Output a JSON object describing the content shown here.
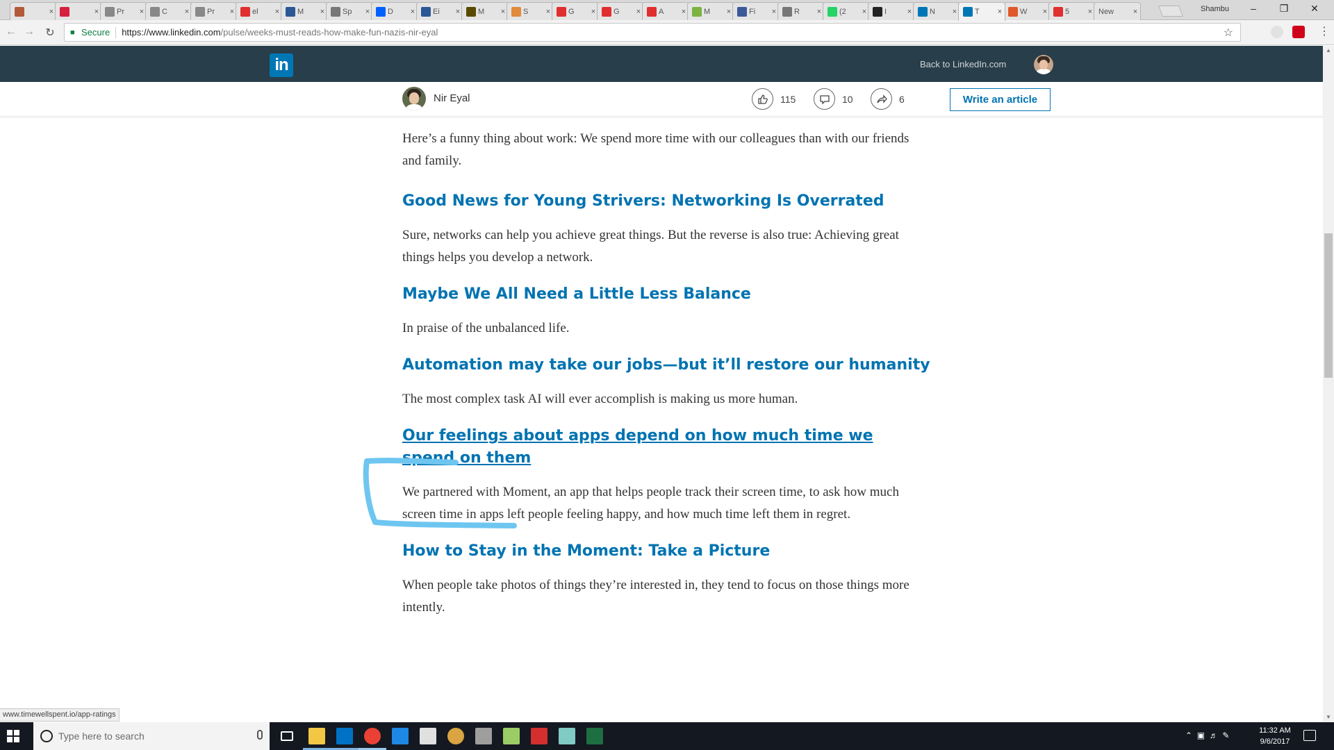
{
  "browser": {
    "tabs": [
      {
        "icon": "generic-page",
        "title": "",
        "color": "#b35a3a",
        "active": false
      },
      {
        "icon": "red-app",
        "title": "",
        "color": "#d6203f",
        "active": false
      },
      {
        "icon": "generic-page",
        "title": "Pr",
        "color": "#888888",
        "active": false
      },
      {
        "icon": "generic-page",
        "title": "C",
        "color": "#888888",
        "active": false
      },
      {
        "icon": "generic-page",
        "title": "Pr",
        "color": "#888888",
        "active": false
      },
      {
        "icon": "adobe",
        "title": "el",
        "color": "#e02f2f",
        "active": false
      },
      {
        "icon": "x-app",
        "title": "M",
        "color": "#2b5797",
        "active": false
      },
      {
        "icon": "stack",
        "title": "Sp",
        "color": "#777777",
        "active": false
      },
      {
        "icon": "dropbox",
        "title": "D",
        "color": "#0061fe",
        "active": false
      },
      {
        "icon": "x-app",
        "title": "Ei",
        "color": "#2b5797",
        "active": false
      },
      {
        "icon": "sp-app",
        "title": "M",
        "color": "#5a4a00",
        "active": false
      },
      {
        "icon": "book",
        "title": "S",
        "color": "#e08a3a",
        "active": false
      },
      {
        "icon": "adobe",
        "title": "G",
        "color": "#e02f2f",
        "active": false
      },
      {
        "icon": "adobe",
        "title": "G",
        "color": "#e02f2f",
        "active": false
      },
      {
        "icon": "adobe",
        "title": "A",
        "color": "#e02f2f",
        "active": false
      },
      {
        "icon": "leaf",
        "title": "M",
        "color": "#7cb342",
        "active": false
      },
      {
        "icon": "facebook",
        "title": "Fi",
        "color": "#3b5998",
        "active": false
      },
      {
        "icon": "gear",
        "title": "R",
        "color": "#777777",
        "active": false
      },
      {
        "icon": "green-circle",
        "title": "(2",
        "color": "#25d366",
        "active": false
      },
      {
        "icon": "medium",
        "title": "I",
        "color": "#222222",
        "active": false
      },
      {
        "icon": "linkedin",
        "title": "N",
        "color": "#0077b5",
        "active": false
      },
      {
        "icon": "linkedin",
        "title": "T",
        "color": "#0077b5",
        "active": true
      },
      {
        "icon": "chart",
        "title": "W",
        "color": "#e0592a",
        "active": false
      },
      {
        "icon": "adobe",
        "title": "5",
        "color": "#e02f2f",
        "active": false
      },
      {
        "icon": "none",
        "title": "New",
        "color": "#dddddd",
        "active": false
      }
    ],
    "profile_name": "Shambu",
    "secure_label": "Secure",
    "url_host": "https://www.linkedin.com",
    "url_path": "/pulse/weeks-must-reads-how-make-fun-nazis-nir-eyal",
    "status_url": "www.timewellspent.io/app-ratings"
  },
  "linkedin": {
    "logo_text": "in",
    "back_link": "Back to LinkedIn.com",
    "author_name": "Nir Eyal",
    "likes": "115",
    "comments": "10",
    "shares": "6",
    "write_article": "Write an article"
  },
  "article": {
    "intro": "Here’s a funny thing about work: We spend more time with our colleagues than with our friends and family.",
    "sections": [
      {
        "heading": "Good News for Young Strivers: Networking Is Overrated",
        "body": "Sure, networks can help you achieve great things. But the reverse is also true: Achieving great things helps you develop a network.",
        "hovered": false
      },
      {
        "heading": "Maybe We All Need a Little Less Balance",
        "body": "In praise of the unbalanced life.",
        "hovered": false
      },
      {
        "heading": "Automation may take our jobs—but it’ll restore our humanity",
        "body": "The most complex task AI will ever accomplish is making us more human.",
        "hovered": false
      },
      {
        "heading": "Our feelings about apps depend on how much time we spend on them",
        "body": "We partnered with Moment, an app that helps people track their screen time, to ask how much screen time in apps left people feeling happy, and how much time left them in regret.",
        "hovered": true
      },
      {
        "heading": "How to Stay in the Moment: Take a Picture",
        "body": "When people take photos of things they’re interested in, they tend to focus on those things more intently.",
        "hovered": false
      }
    ]
  },
  "taskbar": {
    "search_placeholder": "Type here to search",
    "time": "11:32 AM",
    "date": "9/6/2017",
    "apps": [
      {
        "name": "task-view",
        "color": "#ffffff"
      },
      {
        "name": "file-explorer",
        "color": "#f2c744"
      },
      {
        "name": "outlook",
        "color": "#0072c6"
      },
      {
        "name": "chrome",
        "color": "#e94235"
      },
      {
        "name": "edge",
        "color": "#1e88e5"
      },
      {
        "name": "calculator",
        "color": "#e0e0e0"
      },
      {
        "name": "app-tool",
        "color": "#d9a441"
      },
      {
        "name": "app-paint",
        "color": "#9e9e9e"
      },
      {
        "name": "notepad",
        "color": "#9ccc65"
      },
      {
        "name": "acrobat",
        "color": "#d32f2f"
      },
      {
        "name": "notes",
        "color": "#80cbc4"
      },
      {
        "name": "excel",
        "color": "#1d6f42"
      }
    ]
  },
  "colors": {
    "linkedin_blue": "#0073b1",
    "header_bg": "#283e4a",
    "annotation": "#6ec6f0"
  }
}
